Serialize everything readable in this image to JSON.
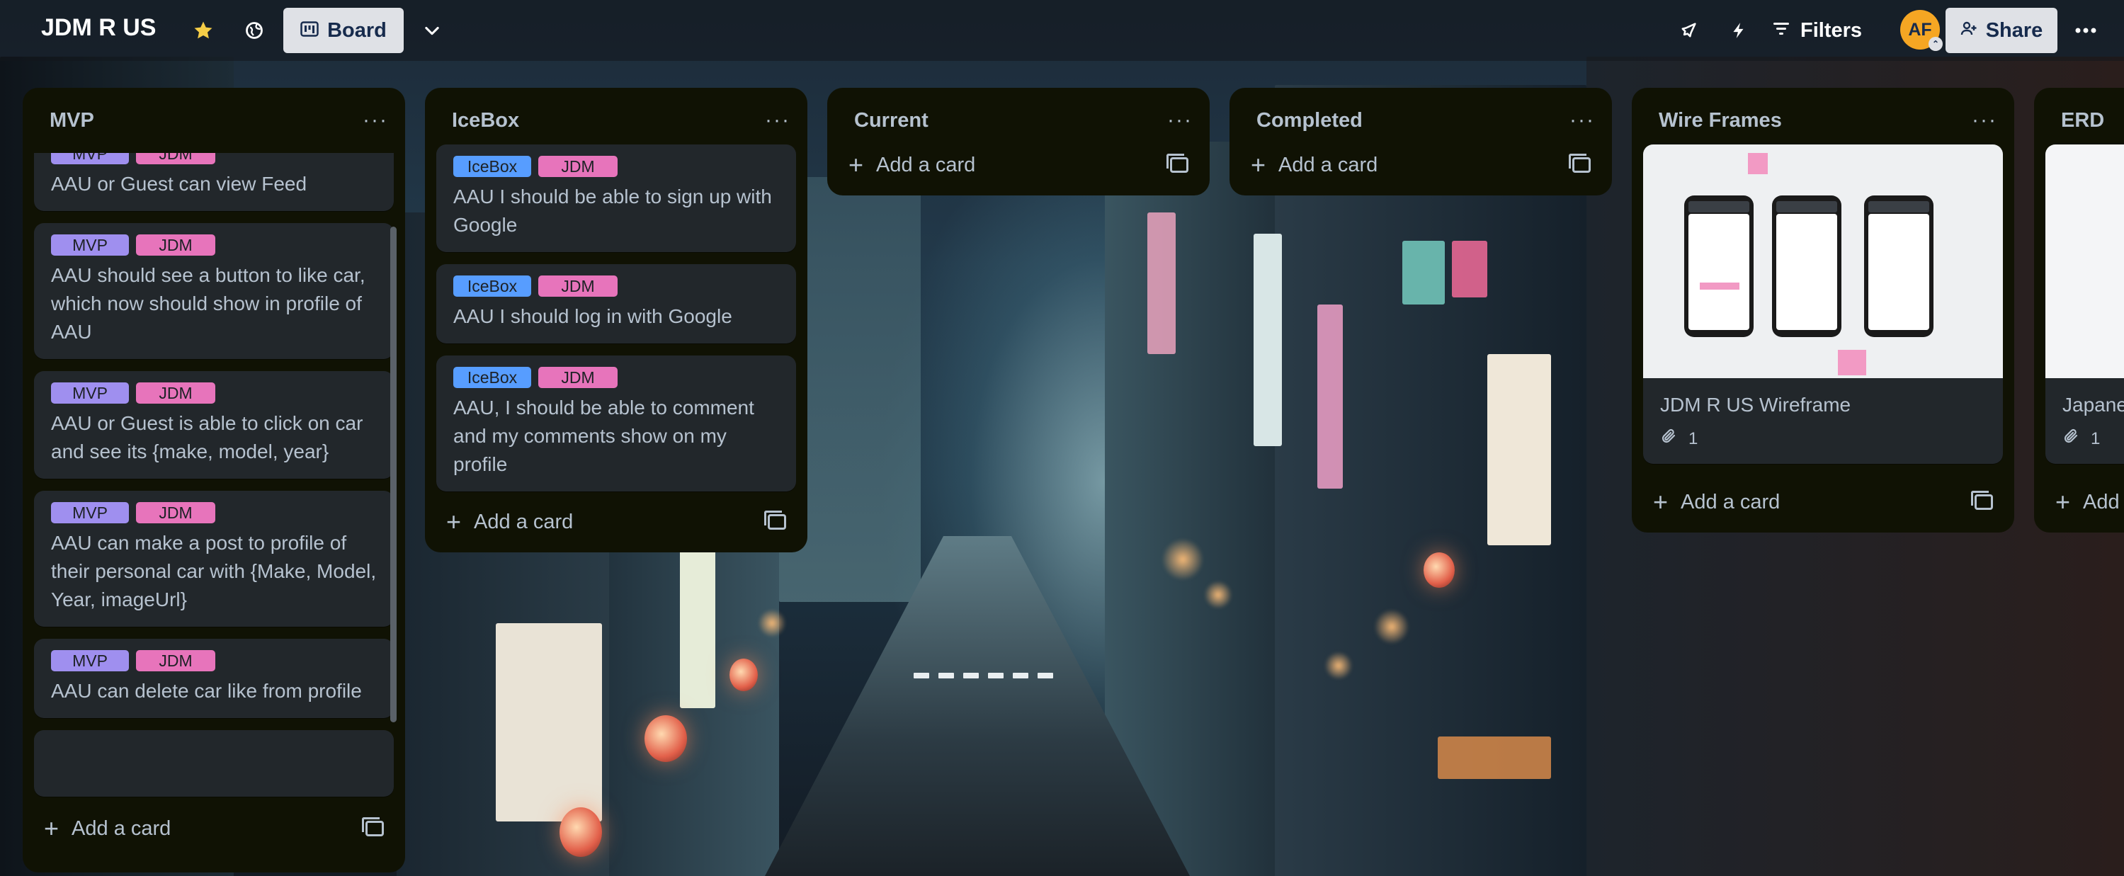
{
  "header": {
    "board_title": "JDM R US",
    "view_label": "Board",
    "filters_label": "Filters",
    "avatar_initials": "AF",
    "share_label": "Share"
  },
  "lists": {
    "mvp": {
      "title": "MVP",
      "add_label": "Add a card",
      "cards": [
        {
          "labels": [
            "MVP",
            "JDM"
          ],
          "text": "AAU or Guest can view Feed"
        },
        {
          "labels": [
            "MVP",
            "JDM"
          ],
          "text": "AAU should see a button to like car, which now should show in profile of AAU"
        },
        {
          "labels": [
            "MVP",
            "JDM"
          ],
          "text": "AAU or Guest is able to click on car and see its {make, model, year}"
        },
        {
          "labels": [
            "MVP",
            "JDM"
          ],
          "text": "AAU can make a post to profile of their personal car with {Make, Model, Year, imageUrl}"
        },
        {
          "labels": [
            "MVP",
            "JDM"
          ],
          "text": "AAU can delete car like from profile"
        }
      ]
    },
    "icebox": {
      "title": "IceBox",
      "add_label": "Add a card",
      "cards": [
        {
          "labels": [
            "IceBox",
            "JDM"
          ],
          "text": "AAU I should be able to sign up with Google"
        },
        {
          "labels": [
            "IceBox",
            "JDM"
          ],
          "text": "AAU I should log in with Google"
        },
        {
          "labels": [
            "IceBox",
            "JDM"
          ],
          "text": "AAU, I should be able to comment and my comments show on my profile"
        }
      ]
    },
    "current": {
      "title": "Current",
      "add_label": "Add a card"
    },
    "completed": {
      "title": "Completed",
      "add_label": "Add a card"
    },
    "wireframes": {
      "title": "Wire Frames",
      "add_label": "Add a card",
      "card": {
        "text": "JDM R US Wireframe",
        "attachments": "1"
      }
    },
    "erd": {
      "title": "ERD",
      "add_label": "Add",
      "card": {
        "text": "Japane",
        "attachments": "1"
      }
    }
  },
  "colors": {
    "list_bg": "#101204",
    "card_bg": "#22272b",
    "label_mvp": "#9f8fef",
    "label_jdm": "#e774bb",
    "label_icebox": "#579dff",
    "avatar": "#f5a623"
  },
  "icons": [
    "star-icon",
    "globe-icon",
    "board-icon",
    "chevron-down-icon",
    "rocket-icon",
    "lightning-icon",
    "filter-icon",
    "share-person-icon",
    "more-icon",
    "plus-icon",
    "template-icon",
    "paperclip-icon"
  ]
}
